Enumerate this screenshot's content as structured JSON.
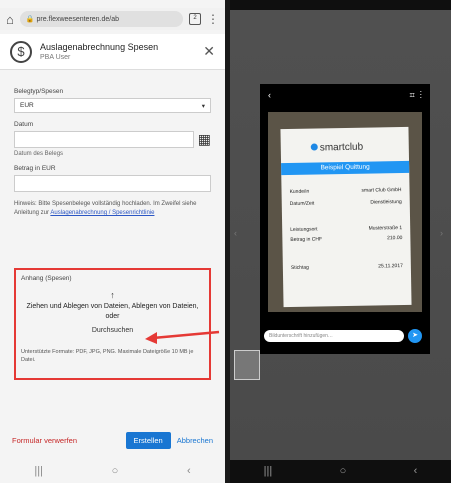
{
  "left": {
    "url": "pre.flexweesenteren.de/ab",
    "tab_count": "2",
    "dialog_title": "Auslagenabrechnung Spesen",
    "dialog_subtitle": "PBA User",
    "fields": {
      "field1_label": "Belegtyp/Spesen",
      "field1_value": "EUR",
      "date_label": "Datum",
      "date_hint": "Datum des Belegs",
      "amount_label": "Betrag in EUR"
    },
    "info_text": "Hinweis: Bitte Spesenbelege vollständig hochladen. Im Zweifel siehe Anleitung zur",
    "info_link": "Auslagenabrechnung / Spesenrichtlinie",
    "upload": {
      "caption": "Anhang (Spesen)",
      "arrow": "↑",
      "main_text": "Ziehen und Ablegen von Dateien, Ablegen von Dateien, oder",
      "browse": "Durchsuchen",
      "small_text": "Unterstützte Formate: PDF, JPG, PNG. Maximale Dateigröße 10 MB je Datei."
    },
    "footer": {
      "delete": "Formular verwerfen",
      "primary": "Erstellen",
      "secondary": "Abbrechen"
    },
    "nav": [
      "|||",
      "○",
      "‹"
    ]
  },
  "right": {
    "doc_logo": "smartclub",
    "doc_banner": "Beispiel Quittung",
    "rows": [
      {
        "k": "Kunde/in",
        "v": "smart Club GmbH"
      },
      {
        "k": "Datum/Zeit",
        "v": "Dienstleistung"
      },
      {
        "k": "Leistungsort",
        "v": "Musterstraße 1"
      },
      {
        "k": "Betrag in CHF",
        "v": "210.00"
      },
      {
        "k": "Stichtag",
        "v": "25.11.2017"
      }
    ],
    "caption_placeholder": "Bildunterschrift hinzufügen…",
    "send_icon": "➤",
    "nav": [
      "|||",
      "○",
      "‹"
    ]
  }
}
